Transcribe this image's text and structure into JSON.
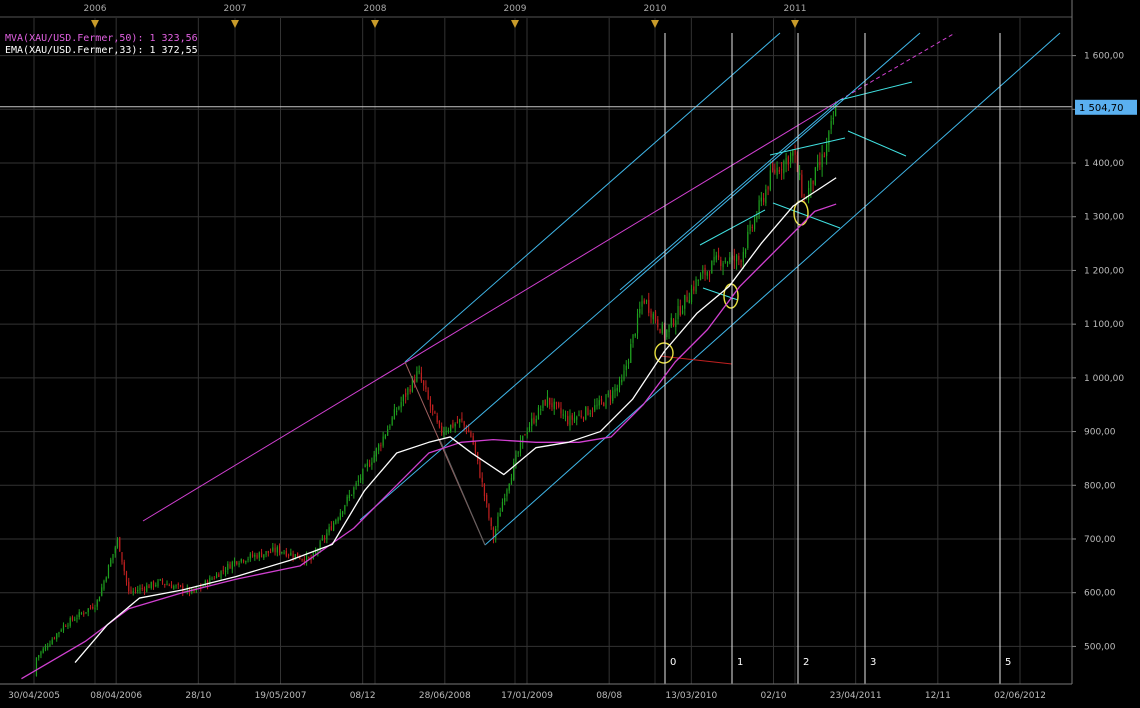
{
  "indicators": {
    "mva_label": "MVA(XAU/USD.Fermer,50): 1 323,56",
    "ema_label": "EMA(XAU/USD.Fermer,33): 1 372,55"
  },
  "colors": {
    "background": "#000000",
    "grid": "#333333",
    "bull": "#1fa01f",
    "bear": "#c02020",
    "mva": "#d040d0",
    "ema": "#ffffff",
    "channel": "#3fb6e8",
    "cyan_marks": "#40e0e0",
    "circle": "#e8e040",
    "current_price_bg": "#5ab0f0",
    "year_marker": "#c89b2a"
  },
  "chart_data": {
    "type": "candlestick",
    "title": "",
    "instrument": "XAU/USD",
    "y_range": [
      430,
      1670
    ],
    "y_ticks": [
      "500,00",
      "600,00",
      "700,00",
      "800,00",
      "900,00",
      "1 000,00",
      "1 100,00",
      "1 200,00",
      "1 300,00",
      "1 400,00",
      "1 500,00",
      "1 600,00"
    ],
    "x_dates": [
      "30/04/2005",
      "08/04/2006",
      "28/10",
      "19/05/2007",
      "08/12",
      "28/06/2008",
      "17/01/2009",
      "08/08",
      "13/03/2010",
      "02/10",
      "23/04/2011",
      "12/11",
      "02/06/2012"
    ],
    "year_markers": [
      "2006",
      "2007",
      "2008",
      "2009",
      "2010",
      "2011"
    ],
    "current_price": "1 504,70",
    "current_price_value": 1504.7,
    "vertical_cycle_labels": [
      "0",
      "1",
      "2",
      "3",
      "5"
    ],
    "grid": true,
    "price_path": [
      {
        "t": 0.0,
        "p": 445
      },
      {
        "t": 0.03,
        "p": 470
      },
      {
        "t": 0.06,
        "p": 540
      },
      {
        "t": 0.09,
        "p": 580
      },
      {
        "t": 0.11,
        "p": 700
      },
      {
        "t": 0.12,
        "p": 600
      },
      {
        "t": 0.15,
        "p": 620
      },
      {
        "t": 0.18,
        "p": 600
      },
      {
        "t": 0.22,
        "p": 660
      },
      {
        "t": 0.26,
        "p": 680
      },
      {
        "t": 0.29,
        "p": 660
      },
      {
        "t": 0.32,
        "p": 760
      },
      {
        "t": 0.35,
        "p": 860
      },
      {
        "t": 0.37,
        "p": 940
      },
      {
        "t": 0.39,
        "p": 1010
      },
      {
        "t": 0.41,
        "p": 900
      },
      {
        "t": 0.43,
        "p": 920
      },
      {
        "t": 0.44,
        "p": 890
      },
      {
        "t": 0.45,
        "p": 800
      },
      {
        "t": 0.46,
        "p": 700
      },
      {
        "t": 0.47,
        "p": 780
      },
      {
        "t": 0.49,
        "p": 900
      },
      {
        "t": 0.51,
        "p": 960
      },
      {
        "t": 0.53,
        "p": 920
      },
      {
        "t": 0.56,
        "p": 950
      },
      {
        "t": 0.58,
        "p": 990
      },
      {
        "t": 0.6,
        "p": 1150
      },
      {
        "t": 0.62,
        "p": 1080
      },
      {
        "t": 0.65,
        "p": 1180
      },
      {
        "t": 0.67,
        "p": 1220
      },
      {
        "t": 0.69,
        "p": 1220
      },
      {
        "t": 0.72,
        "p": 1380
      },
      {
        "t": 0.74,
        "p": 1420
      },
      {
        "t": 0.75,
        "p": 1330
      },
      {
        "t": 0.77,
        "p": 1420
      },
      {
        "t": 0.78,
        "p": 1505
      }
    ],
    "mva_path": [
      {
        "t": 0.02,
        "p": 440
      },
      {
        "t": 0.08,
        "p": 510
      },
      {
        "t": 0.12,
        "p": 570
      },
      {
        "t": 0.17,
        "p": 600
      },
      {
        "t": 0.22,
        "p": 625
      },
      {
        "t": 0.28,
        "p": 650
      },
      {
        "t": 0.33,
        "p": 720
      },
      {
        "t": 0.37,
        "p": 800
      },
      {
        "t": 0.4,
        "p": 860
      },
      {
        "t": 0.43,
        "p": 880
      },
      {
        "t": 0.46,
        "p": 885
      },
      {
        "t": 0.5,
        "p": 880
      },
      {
        "t": 0.54,
        "p": 880
      },
      {
        "t": 0.57,
        "p": 890
      },
      {
        "t": 0.6,
        "p": 950
      },
      {
        "t": 0.63,
        "p": 1030
      },
      {
        "t": 0.66,
        "p": 1090
      },
      {
        "t": 0.69,
        "p": 1170
      },
      {
        "t": 0.73,
        "p": 1250
      },
      {
        "t": 0.76,
        "p": 1310
      },
      {
        "t": 0.78,
        "p": 1323.56
      }
    ],
    "ema_path": [
      {
        "t": 0.07,
        "p": 470
      },
      {
        "t": 0.1,
        "p": 540
      },
      {
        "t": 0.13,
        "p": 590
      },
      {
        "t": 0.17,
        "p": 605
      },
      {
        "t": 0.22,
        "p": 630
      },
      {
        "t": 0.27,
        "p": 660
      },
      {
        "t": 0.31,
        "p": 690
      },
      {
        "t": 0.34,
        "p": 790
      },
      {
        "t": 0.37,
        "p": 860
      },
      {
        "t": 0.4,
        "p": 880
      },
      {
        "t": 0.42,
        "p": 890
      },
      {
        "t": 0.44,
        "p": 860
      },
      {
        "t": 0.47,
        "p": 820
      },
      {
        "t": 0.5,
        "p": 870
      },
      {
        "t": 0.53,
        "p": 880
      },
      {
        "t": 0.56,
        "p": 900
      },
      {
        "t": 0.59,
        "p": 960
      },
      {
        "t": 0.62,
        "p": 1050
      },
      {
        "t": 0.65,
        "p": 1120
      },
      {
        "t": 0.68,
        "p": 1170
      },
      {
        "t": 0.71,
        "p": 1250
      },
      {
        "t": 0.74,
        "p": 1320
      },
      {
        "t": 0.78,
        "p": 1372.55
      }
    ]
  }
}
